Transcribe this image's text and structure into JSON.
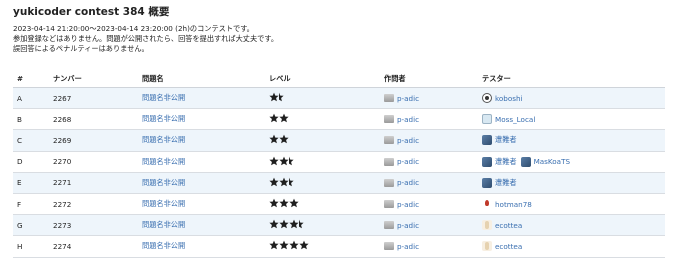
{
  "page": {
    "title": "yukicoder contest 384 概要",
    "description": [
      "2023-04-14 21:20:00〜2023-04-14 23:20:00 (2h)のコンテストです。",
      "参加登録などはありません。問題が公開されたら、回答を提出すれば大丈夫です。",
      "誤回答によるペナルティーはありません。"
    ]
  },
  "table": {
    "headers": [
      "#",
      "ナンバー",
      "問題名",
      "レベル",
      "作問者",
      "テスター"
    ],
    "rows": [
      {
        "id": "A",
        "number": "2267",
        "name": "問題名非公開",
        "level": 1.5,
        "author": "p-adic",
        "testers": [
          {
            "name": "koboshi",
            "avatar": "koboshi-avatar"
          }
        ]
      },
      {
        "id": "B",
        "number": "2268",
        "name": "問題名非公開",
        "level": 2,
        "author": "p-adic",
        "testers": [
          {
            "name": "Moss_Local",
            "avatar": "moss-avatar"
          }
        ]
      },
      {
        "id": "C",
        "number": "2269",
        "name": "問題名非公開",
        "level": 2,
        "author": "p-adic",
        "testers": [
          {
            "name": "遭難者",
            "avatar": "blue-avatar"
          }
        ]
      },
      {
        "id": "D",
        "number": "2270",
        "name": "問題名非公開",
        "level": 2.5,
        "author": "p-adic",
        "testers": [
          {
            "name": "遭難者",
            "avatar": "blue-avatar"
          },
          {
            "name": "MasKoaTS",
            "avatar": "blue-avatar"
          }
        ]
      },
      {
        "id": "E",
        "number": "2271",
        "name": "問題名非公開",
        "level": 2.5,
        "author": "p-adic",
        "testers": [
          {
            "name": "遭難者",
            "avatar": "blue-avatar"
          }
        ]
      },
      {
        "id": "F",
        "number": "2272",
        "name": "問題名非公開",
        "level": 3,
        "author": "p-adic",
        "testers": [
          {
            "name": "hotman78",
            "avatar": "hotman-avatar"
          }
        ]
      },
      {
        "id": "G",
        "number": "2273",
        "name": "問題名非公開",
        "level": 3.5,
        "author": "p-adic",
        "testers": [
          {
            "name": "ecottea",
            "avatar": "ecottea-avatar"
          }
        ]
      },
      {
        "id": "H",
        "number": "2274",
        "name": "問題名非公開",
        "level": 4,
        "author": "p-adic",
        "testers": [
          {
            "name": "ecottea",
            "avatar": "ecottea-avatar"
          }
        ]
      }
    ]
  },
  "colors": {
    "link": "#3a6fb0",
    "star": "#1f1f1f",
    "row_alt": "#eef5fb"
  }
}
